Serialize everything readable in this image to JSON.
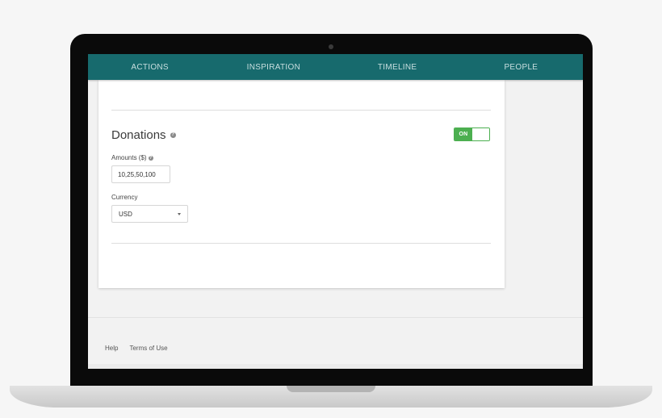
{
  "nav": {
    "items": [
      {
        "label": "ACTIONS"
      },
      {
        "label": "INSPIRATION"
      },
      {
        "label": "TIMELINE"
      },
      {
        "label": "PEOPLE"
      }
    ]
  },
  "donations": {
    "title": "Donations",
    "toggle_label": "ON",
    "toggle_state": "on",
    "amounts_label": "Amounts ($)",
    "amounts_value": "10,25,50,100",
    "currency_label": "Currency",
    "currency_value": "USD"
  },
  "footer": {
    "links": [
      {
        "label": "Help"
      },
      {
        "label": "Terms of Use"
      }
    ]
  },
  "colors": {
    "nav_bg": "#176a6d",
    "toggle_on": "#4caf50"
  },
  "icons": {
    "help": "help-circle-icon",
    "dropdown": "chevron-down-icon"
  }
}
